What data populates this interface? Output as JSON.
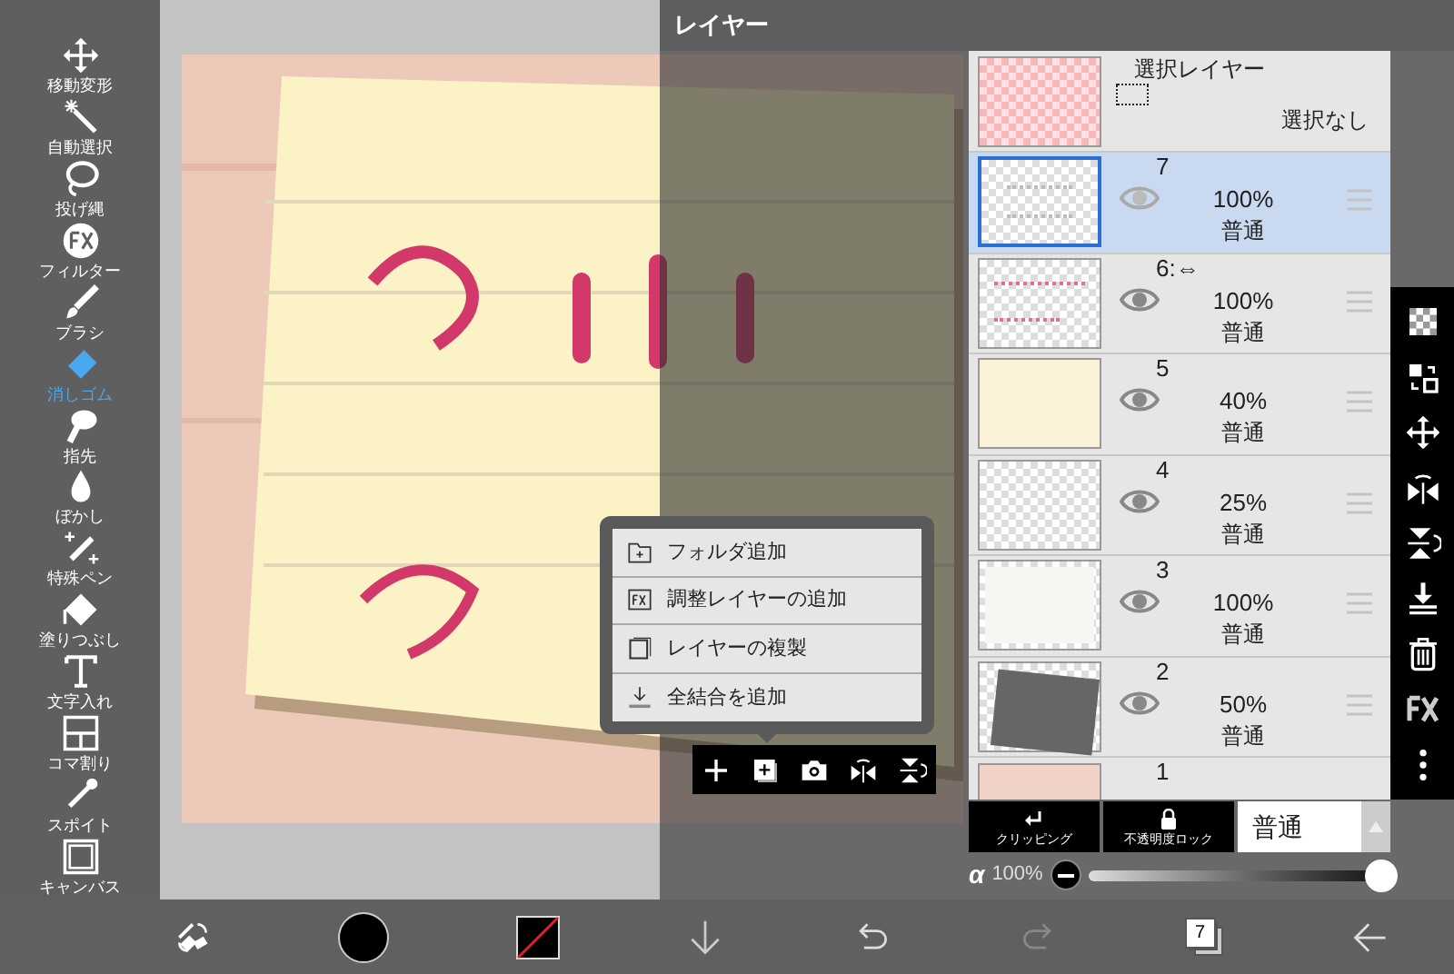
{
  "tools": [
    {
      "label": "移動変形",
      "selected": false
    },
    {
      "label": "自動選択",
      "selected": false
    },
    {
      "label": "投げ縄",
      "selected": false
    },
    {
      "label": "フィルター",
      "selected": false
    },
    {
      "label": "ブラシ",
      "selected": false
    },
    {
      "label": "消しゴム",
      "selected": true
    },
    {
      "label": "指先",
      "selected": false
    },
    {
      "label": "ぼかし",
      "selected": false
    },
    {
      "label": "特殊ペン",
      "selected": false
    },
    {
      "label": "塗りつぶし",
      "selected": false
    },
    {
      "label": "文字入れ",
      "selected": false
    },
    {
      "label": "コマ割り",
      "selected": false
    },
    {
      "label": "スポイト",
      "selected": false
    },
    {
      "label": "キャンバス",
      "selected": false
    }
  ],
  "layer_panel": {
    "title": "レイヤー",
    "selection_layer": {
      "name": "選択レイヤー",
      "status": "選択なし"
    },
    "layers": [
      {
        "name": "7",
        "opacity": "100%",
        "blend": "普通",
        "selected": true,
        "visible": true
      },
      {
        "name": "6:⇔",
        "opacity": "100%",
        "blend": "普通",
        "selected": false,
        "visible": true
      },
      {
        "name": "5",
        "opacity": "40%",
        "blend": "普通",
        "selected": false,
        "visible": true
      },
      {
        "name": "4",
        "opacity": "25%",
        "blend": "普通",
        "selected": false,
        "visible": true
      },
      {
        "name": "3",
        "opacity": "100%",
        "blend": "普通",
        "selected": false,
        "visible": true
      },
      {
        "name": "2",
        "opacity": "50%",
        "blend": "普通",
        "selected": false,
        "visible": true
      },
      {
        "name": "1"
      }
    ],
    "clipping": "クリッピング",
    "alpha_lock": "不透明度ロック",
    "blend_mode": "普通",
    "alpha_symbol": "α",
    "alpha_value": "100%",
    "alpha_slider": {
      "level": 0.97
    },
    "add_menu": [
      "フォルダ追加",
      "調整レイヤーの追加",
      "レイヤーの複製",
      "全結合を追加"
    ]
  },
  "bottom_bar": {
    "layer_count": "7",
    "redo_disabled": true
  }
}
